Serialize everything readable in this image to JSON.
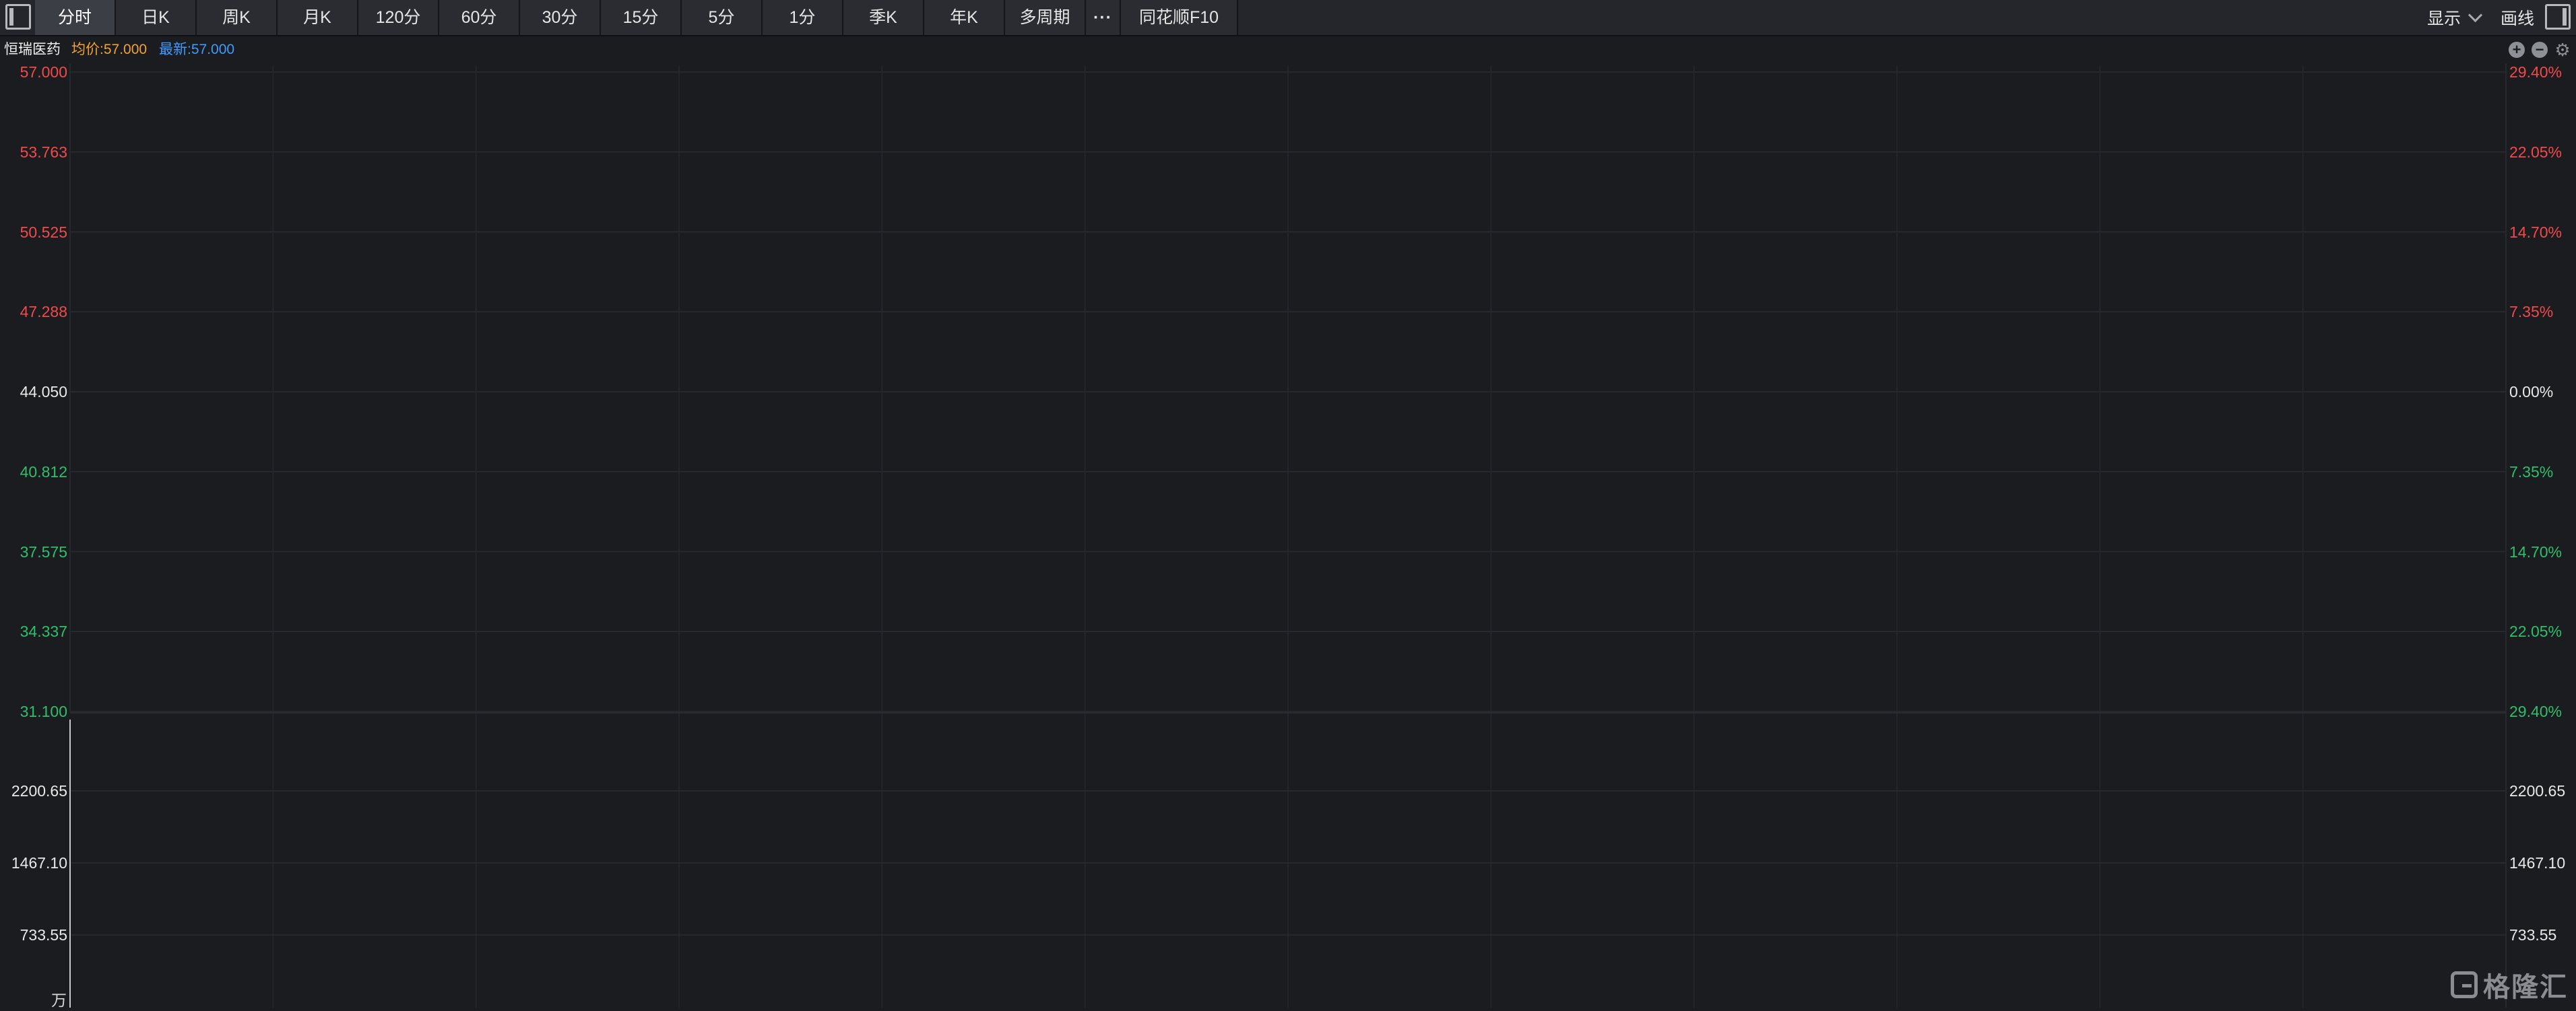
{
  "toolbar": {
    "tabs": [
      {
        "label": "分时",
        "active": true
      },
      {
        "label": "日K",
        "active": false
      },
      {
        "label": "周K",
        "active": false
      },
      {
        "label": "月K",
        "active": false
      },
      {
        "label": "120分",
        "active": false
      },
      {
        "label": "60分",
        "active": false
      },
      {
        "label": "30分",
        "active": false
      },
      {
        "label": "15分",
        "active": false
      },
      {
        "label": "5分",
        "active": false
      },
      {
        "label": "1分",
        "active": false
      },
      {
        "label": "季K",
        "active": false
      },
      {
        "label": "年K",
        "active": false
      },
      {
        "label": "多周期",
        "active": false
      }
    ],
    "more_label": "···",
    "f10_label": "同花顺F10",
    "display_label": "显示",
    "draw_label": "画线"
  },
  "info": {
    "stock_name": "恒瑞医药",
    "avg_price": "均价:57.000",
    "latest_price": "最新:57.000"
  },
  "zoom": {
    "in_symbol": "+",
    "out_symbol": "−",
    "settings_symbol": "⚙"
  },
  "chart_data": {
    "type": "line",
    "title": "",
    "price_axis_left": [
      "57.000",
      "53.763",
      "50.525",
      "47.288",
      "44.050",
      "40.812",
      "37.575",
      "34.337",
      "31.100"
    ],
    "price_axis_right": [
      "29.40%",
      "22.05%",
      "14.70%",
      "7.35%",
      "0.00%",
      "7.35%",
      "14.70%",
      "22.05%",
      "29.40%"
    ],
    "price_axis_tones": [
      "up",
      "up",
      "up",
      "up",
      "flat",
      "down",
      "down",
      "down",
      "down"
    ],
    "volume_axis_left": [
      "2200.65",
      "1467.10",
      "733.55"
    ],
    "volume_axis_right": [
      "2200.65",
      "1467.10",
      "733.55"
    ],
    "volume_unit": "万",
    "ylim": [
      31.1,
      57.0
    ],
    "prev_close": 44.05,
    "series": [],
    "grid": true,
    "colors": {
      "up": "#f24a4a",
      "down": "#2fbf6a",
      "flat": "#e8e8e8",
      "avg": "#f3a134",
      "latest": "#3f9bff"
    }
  },
  "watermark": "格隆汇"
}
